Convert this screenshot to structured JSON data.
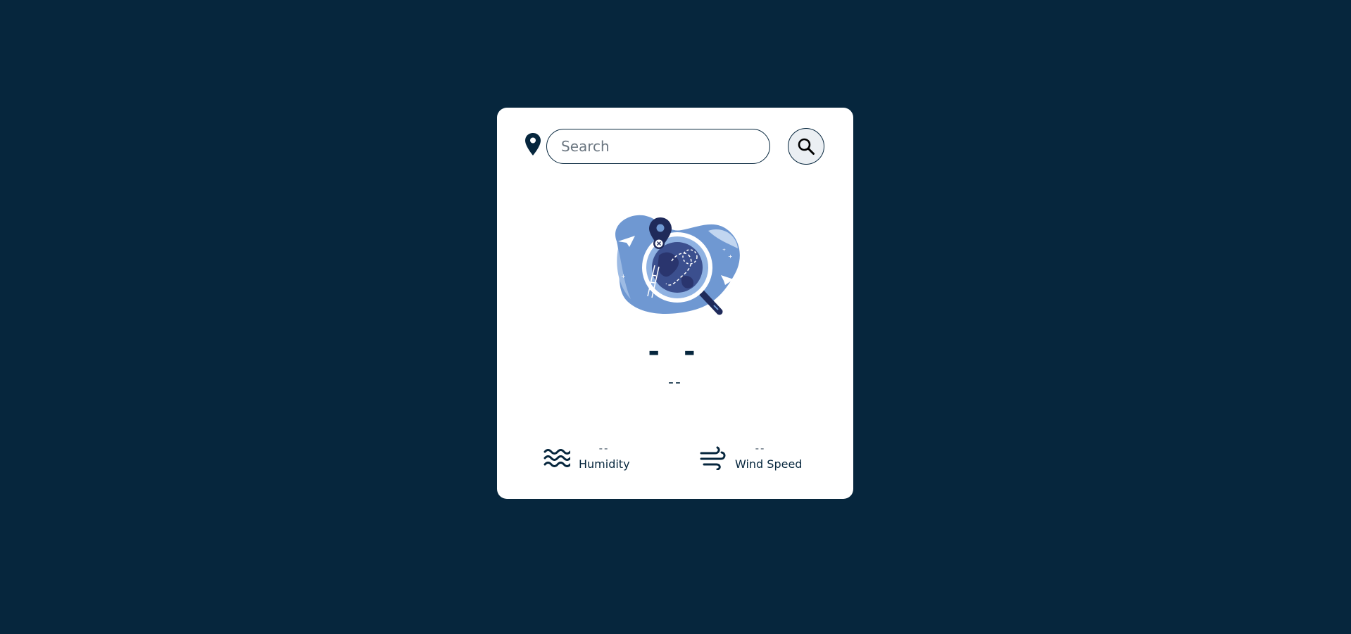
{
  "search": {
    "placeholder": "Search",
    "value": "",
    "button_icon": "search-icon",
    "location_icon": "map-pin-icon"
  },
  "weather": {
    "illustration": "location-not-found-illustration",
    "temperature": "- -",
    "description": "--"
  },
  "details": {
    "humidity": {
      "icon": "water-waves-icon",
      "value": "--",
      "label": "Humidity"
    },
    "wind": {
      "icon": "wind-icon",
      "value": "--",
      "label": "Wind Speed"
    }
  },
  "colors": {
    "background": "#06263d",
    "card": "#ffffff",
    "accent": "#06263d",
    "illustration_blue": "#6f98d2"
  }
}
